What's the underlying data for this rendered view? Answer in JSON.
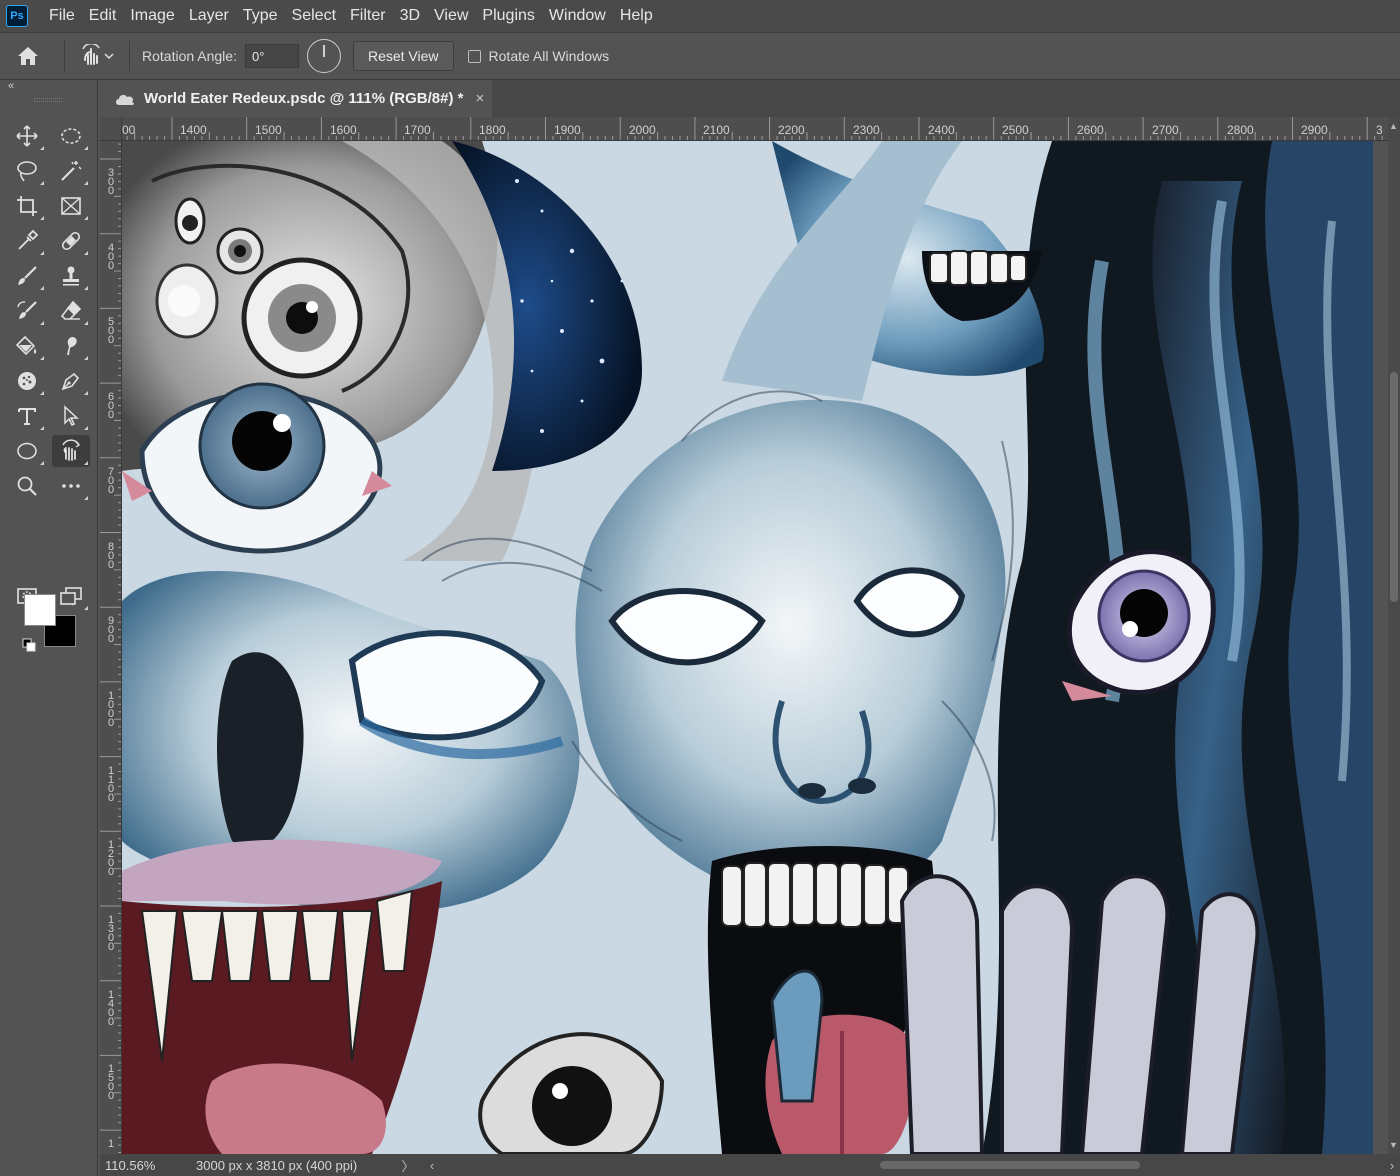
{
  "app": {
    "logo": "Ps"
  },
  "menu": [
    "File",
    "Edit",
    "Image",
    "Layer",
    "Type",
    "Select",
    "Filter",
    "3D",
    "View",
    "Plugins",
    "Window",
    "Help"
  ],
  "options": {
    "rotation_label": "Rotation Angle:",
    "rotation_value": "0°",
    "reset_label": "Reset View",
    "rotate_all_label": "Rotate All Windows",
    "rotate_all_checked": false
  },
  "toolbar": {
    "collapse": "«",
    "foreground_color": "#ffffff",
    "background_color": "#000000",
    "swap_glyph": "⇆"
  },
  "document": {
    "title": "World Eater Redeux.psdc @ 111% (RGB/8#) *",
    "close": "×"
  },
  "rulers": {
    "horizontal": [
      "00",
      "1400",
      "1500",
      "1600",
      "1700",
      "1800",
      "1900",
      "2000",
      "2100",
      "2200",
      "2300",
      "2400",
      "2500",
      "2600",
      "2700",
      "2800",
      "2900",
      "3"
    ],
    "vertical": [
      "300",
      "400",
      "500",
      "600",
      "700",
      "800",
      "900",
      "1000",
      "1100",
      "1200",
      "1300",
      "1400",
      "1500",
      "1"
    ]
  },
  "status": {
    "zoom": "110.56%",
    "info": "3000 px x 3810 px (400 ppi)",
    "arrow": "〉",
    "scroll_left": "‹",
    "scroll_right": "›"
  },
  "icons": {
    "home": "home-icon",
    "rotate_view": "rotate-view-icon",
    "cloud": "cloud-icon"
  }
}
